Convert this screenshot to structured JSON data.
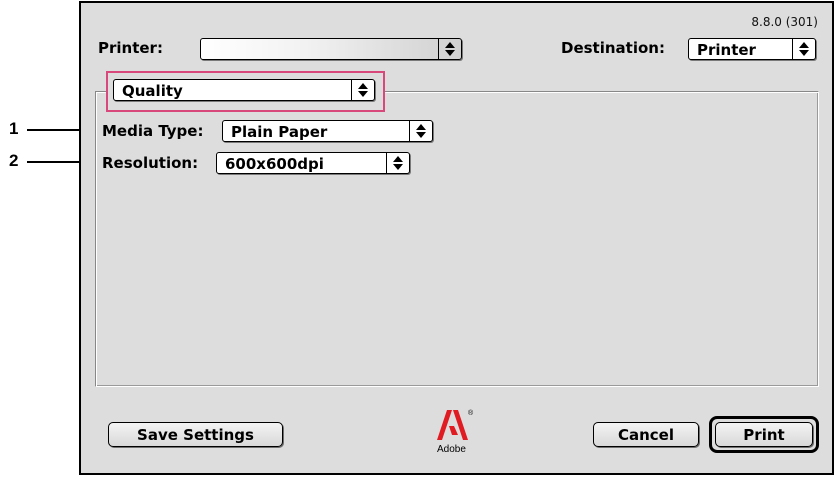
{
  "version_text": "8.8.0 (301)",
  "printer": {
    "label": "Printer:",
    "value": ""
  },
  "destination": {
    "label": "Destination:",
    "value": "Printer"
  },
  "panel_menu": {
    "value": "Quality"
  },
  "media_type": {
    "label": "Media Type:",
    "value": "Plain Paper"
  },
  "resolution": {
    "label": "Resolution:",
    "value": "600x600dpi"
  },
  "callouts": [
    "1",
    "2"
  ],
  "buttons": {
    "save_settings": "Save Settings",
    "cancel": "Cancel",
    "print": "Print"
  },
  "logo": {
    "text": "Adobe",
    "registered": "®"
  },
  "colors": {
    "dialog_bg": "#dddddd",
    "highlight": "#d8487a",
    "adobe_red": "#e01b22"
  },
  "icons": {
    "popup_arrows": "up-down-arrows-icon",
    "logo": "adobe-logo-icon"
  }
}
